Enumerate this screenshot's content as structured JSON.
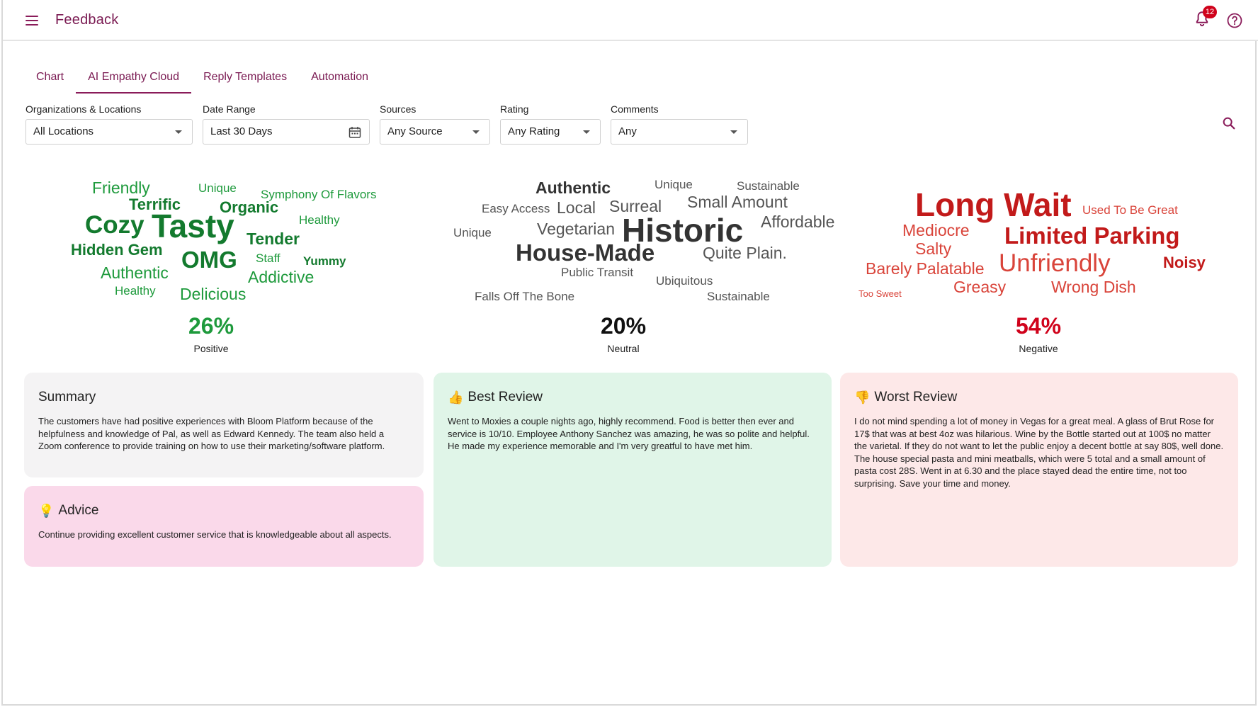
{
  "header": {
    "menu_icon": "menu-icon",
    "title": "Feedback",
    "notification_count": "12",
    "bell_icon": "bell-icon",
    "help_icon": "help-icon"
  },
  "tabs": [
    {
      "label": "Chart",
      "active": false
    },
    {
      "label": "AI Empathy Cloud",
      "active": true
    },
    {
      "label": "Reply Templates",
      "active": false
    },
    {
      "label": "Automation",
      "active": false
    }
  ],
  "filters": {
    "organizations": {
      "label": "Organizations & Locations",
      "value": "All Locations"
    },
    "date_range": {
      "label": "Date Range",
      "value": "Last 30 Days"
    },
    "sources": {
      "label": "Sources",
      "value": "Any Source"
    },
    "rating": {
      "label": "Rating",
      "value": "Any Rating"
    },
    "comments": {
      "label": "Comments",
      "value": "Any"
    }
  },
  "clouds": {
    "positive": {
      "words": [
        "Friendly",
        "Unique",
        "Symphony Of Flavors",
        "Terrific",
        "Organic",
        "Healthy",
        "Cozy",
        "Tasty",
        "Tender",
        "Hidden Gem",
        "OMG",
        "Staff",
        "Yummy",
        "Authentic",
        "Addictive",
        "Healthy",
        "Delicious"
      ],
      "percent": "26%",
      "label": "Positive",
      "color": "#1e9a3c"
    },
    "neutral": {
      "words": [
        "Authentic",
        "Unique",
        "Sustainable",
        "Easy Access",
        "Local",
        "Surreal",
        "Small Amount",
        "Vegetarian",
        "Historic",
        "Affordable",
        "Unique",
        "House-Made",
        "Quite Plain.",
        "Public Transit",
        "Ubiquitous",
        "Falls Off The Bone",
        "Sustainable"
      ],
      "percent": "20%",
      "label": "Neutral",
      "color": "#111111"
    },
    "negative": {
      "words": [
        "Long Wait",
        "Used To Be Great",
        "Mediocre",
        "Limited Parking",
        "Salty",
        "Barely Palatable",
        "Unfriendly",
        "Noisy",
        "Greasy",
        "Wrong Dish",
        "Too Sweet"
      ],
      "percent": "54%",
      "label": "Negative",
      "color": "#d0021b"
    }
  },
  "summary": {
    "title": "Summary",
    "text": "The customers have had positive experiences with Bloom Platform because of the helpfulness and knowledge of Pal, as well as Edward Kennedy. The team also held a Zoom conference to provide training on how to use their marketing/software platform."
  },
  "advice": {
    "icon": "💡",
    "title": "Advice",
    "text": "Continue providing excellent customer service that is knowledgeable about all aspects."
  },
  "best_review": {
    "icon": "👍",
    "title": "Best Review",
    "text": "Went to Moxies a couple nights ago, highly recommend. Food is better then ever and service is 10/10. Employee Anthony Sanchez was amazing, he was so polite and helpful. He made my experience memorable and I'm very greatful to have met him."
  },
  "worst_review": {
    "icon": "👎",
    "title": "Worst Review",
    "text": "I do not mind spending a lot of money in Vegas for a great meal. A glass of Brut Rose for 17$ that was at best 4oz was hilarious. Wine by the Bottle started out at 100$ no matter the varietal. If they do not want to let the public enjoy a decent bottle at say 80$, well done. The house special pasta and mini meatballs, which were 5 total and a small amount of pasta cost 28S. Went in at 6.30 and the place stayed dead the entire time, not too surprising. Save your time and money."
  },
  "colors": {
    "brand": "#7a1a52",
    "summary_bg": "#f4f3f4",
    "advice_bg": "#fad9ea",
    "best_bg": "#e0f5e8",
    "worst_bg": "#fde8e8"
  }
}
